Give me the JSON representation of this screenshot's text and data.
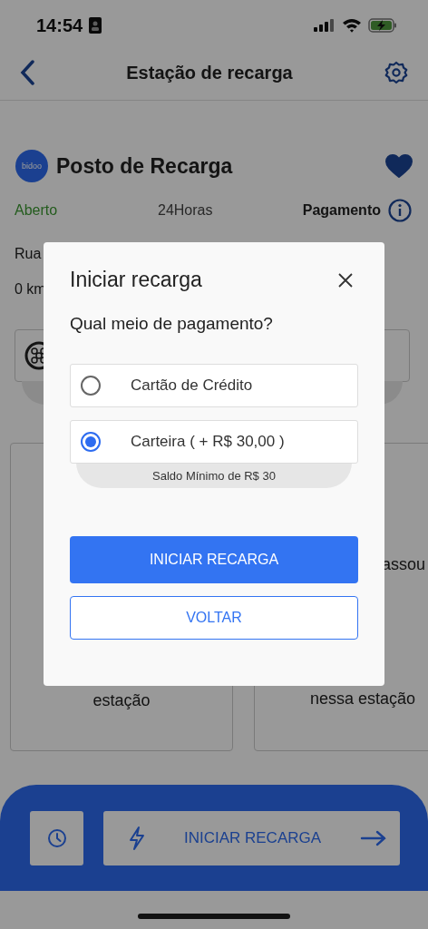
{
  "status_bar": {
    "time": "14:54"
  },
  "nav": {
    "title": "Estação de recarga"
  },
  "station": {
    "logo_text": "bidoo",
    "name": "Posto de Recarga",
    "favorite": true,
    "open_status": "Aberto",
    "hours": "24Horas",
    "payment_label": "Pagamento",
    "address": "Rua",
    "distance": "0 km"
  },
  "stat_cards": [
    {
      "lines": [
        "estação"
      ]
    },
    {
      "lines": [
        "assou",
        "nessa estação"
      ]
    }
  ],
  "bottom_bar": {
    "start_label": "INICIAR RECARGA"
  },
  "modal": {
    "title": "Iniciar recarga",
    "question": "Qual meio de pagamento?",
    "options": [
      {
        "label": "Cartão de Crédito",
        "selected": false
      },
      {
        "label": "Carteira ( + R$ 30,00 )",
        "selected": true,
        "note": "Saldo Mínimo de R$ 30"
      }
    ],
    "primary_button": "INICIAR RECARGA",
    "secondary_button": "VOLTAR"
  }
}
